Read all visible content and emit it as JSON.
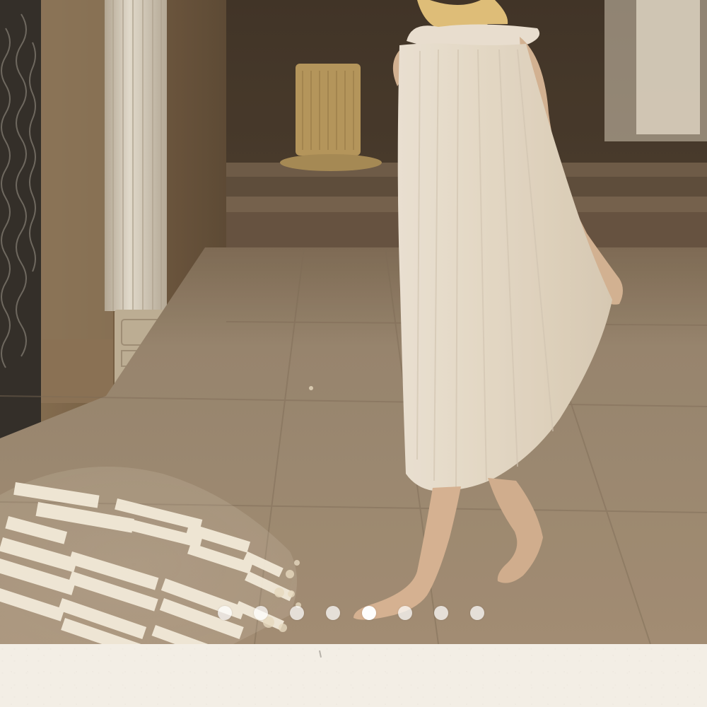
{
  "hero": {
    "image_description": "",
    "colors": {
      "floor": "#a59076",
      "wall": "#7b654b",
      "dress": "#eee6d6",
      "skin": "#d7b597",
      "hair": "#e7c97c",
      "background_panel": "#f3eee5"
    }
  },
  "carousel": {
    "total_slides": 8,
    "active_index": 4
  }
}
